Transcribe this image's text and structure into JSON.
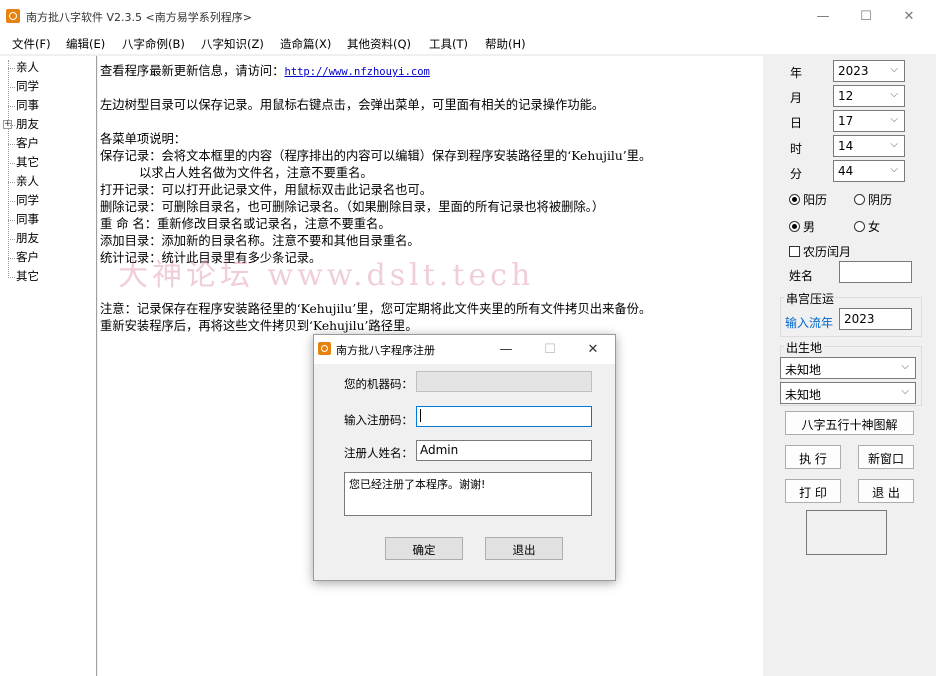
{
  "window": {
    "title": "南方批八字软件 V2.3.5   <南方易学系列程序>",
    "minimize": "—",
    "maximize": "☐",
    "close": "✕"
  },
  "menu": [
    "文件(F)",
    "编辑(E)",
    "八字命例(B)",
    "八字知识(Z)",
    "造命篇(X)",
    "其他资料(Q)",
    "工具(T)",
    "帮助(H)"
  ],
  "tree": {
    "expand_symbol": "+",
    "items": [
      "亲人",
      "同学",
      "同事",
      "朋友",
      "客户",
      "其它",
      "亲人",
      "同学",
      "同事",
      "朋友",
      "客户",
      "其它"
    ]
  },
  "editor": {
    "line1_prefix": "查看程序最新更新信息，请访问：",
    "line1_link": "http://www.nfzhouyi.com",
    "lines": [
      "左边树型目录可以保存记录。用鼠标右键点击，会弹出菜单，可里面有相关的记录操作功能。",
      "各菜单项说明：",
      "保存记录：会将文本框里的内容（程序排出的内容可以编辑）保存到程序安装路径里的‘Kehujilu’里。",
      "          以求占人姓名做为文件名，注意不要重名。",
      "打开记录：可以打开此记录文件，用鼠标双击此记录名也可。",
      "删除记录：可删除目录名，也可删除记录名。（如果删除目录，里面的所有记录也将被删除。）",
      "重 命 名：重新修改目录名或记录名，注意不要重名。",
      "添加目录：添加新的目录名称。注意不要和其他目录重名。",
      "统计记录：统计此目录里有多少条记录。",
      "注意：记录保存在程序安装路径里的‘Kehujilu’里，您可定期将此文件夹里的所有文件拷贝出来备份。",
      "重新安装程序后，再将这些文件拷贝到‘Kehujilu’路径里。"
    ],
    "watermark": "大神论坛 www.dslt.tech"
  },
  "panel": {
    "year_label": "年",
    "year_value": "2023",
    "month_label": "月",
    "month_value": "12",
    "day_label": "日",
    "day_value": "17",
    "hour_label": "时",
    "hour_value": "14",
    "minute_label": "分",
    "minute_value": "44",
    "solar": "阳历",
    "lunar": "阴历",
    "male": "男",
    "female": "女",
    "leap_month": "农历闰月",
    "name_label": "姓名",
    "name_value": "",
    "group1_title": "串宫压运",
    "flow_year_label": "输入流年",
    "flow_year_value": "2023",
    "group2_title": "出生地",
    "birthplace1": "未知地",
    "birthplace2": "未知地",
    "btn_chart": "八字五行十神图解",
    "btn_run": "执 行",
    "btn_new": "新窗口",
    "btn_print": "打 印",
    "btn_exit": "退 出",
    "accent_blue": "#0066cc"
  },
  "dialog": {
    "title": "南方批八字程序注册",
    "machine_code_label": "您的机器码：",
    "machine_code_value": "",
    "reg_code_label": "输入注册码：",
    "reg_code_value": "",
    "reg_name_label": "注册人姓名：",
    "reg_name_value": "Admin",
    "message": "您已经注册了本程序。谢谢!",
    "ok": "确定",
    "cancel": "退出",
    "minimize": "—",
    "maximize": "☐",
    "close": "✕"
  }
}
